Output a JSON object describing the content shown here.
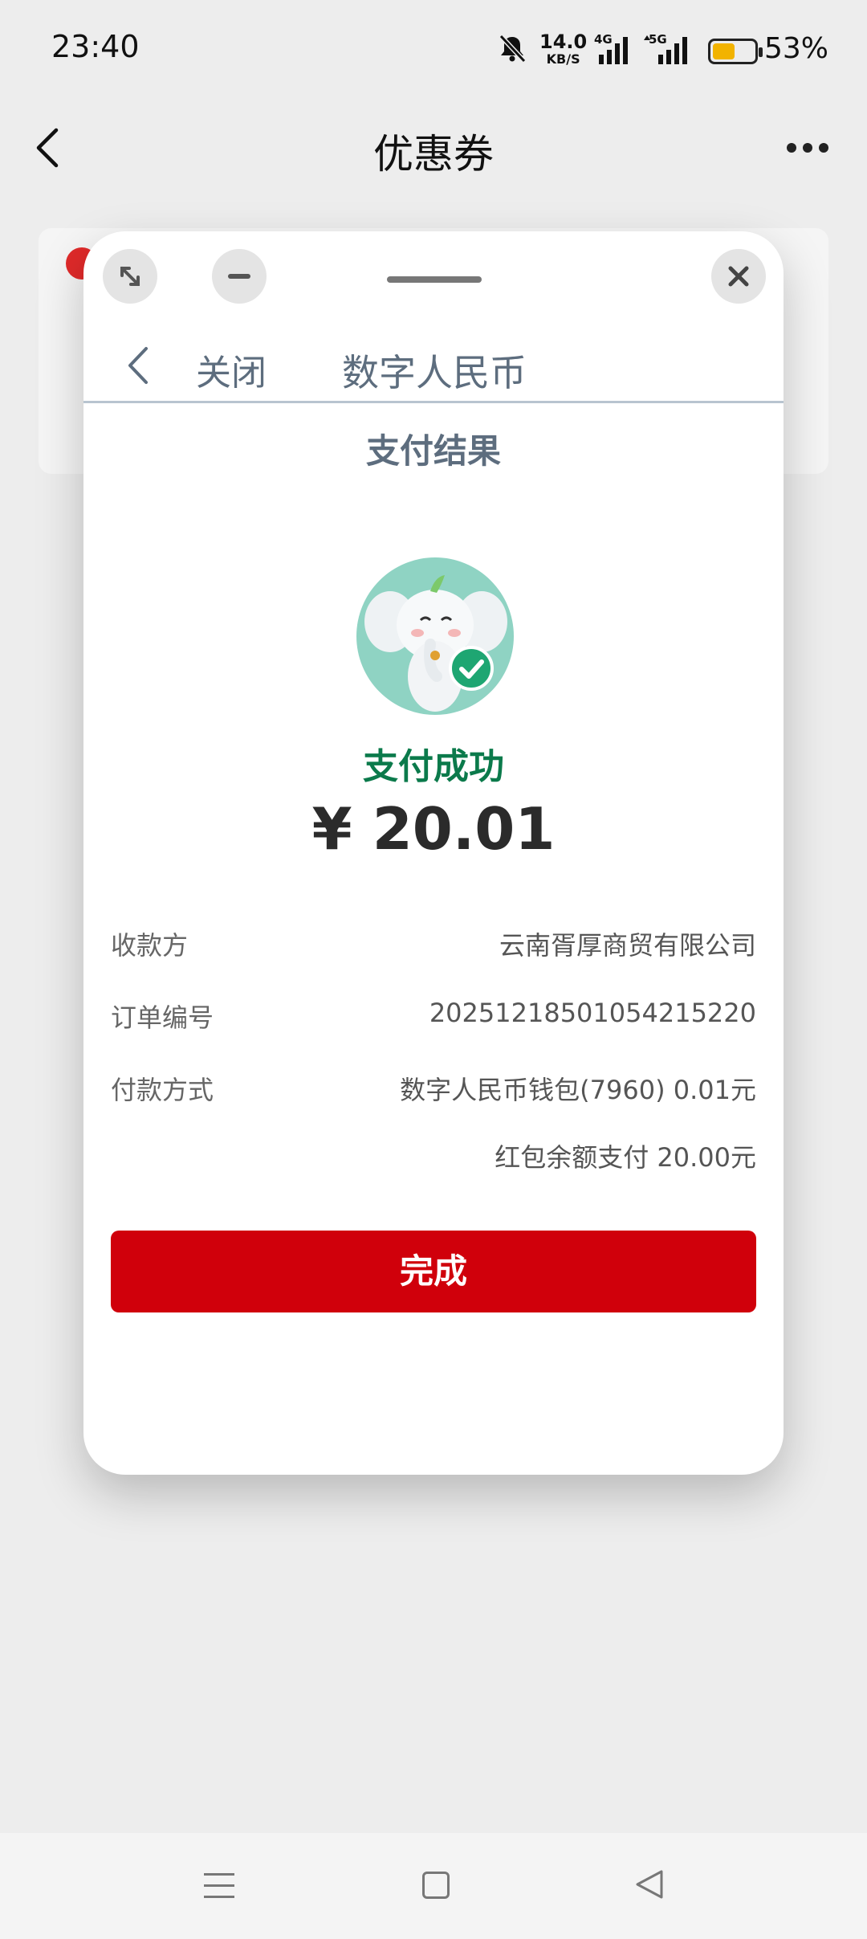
{
  "status_bar": {
    "time": "23:40",
    "net_speed": "14.0",
    "net_unit": "KB/S",
    "signal1": "4G",
    "signal2": "5G",
    "battery_percent": "53%",
    "battery_level": 0.53,
    "icons": [
      "bell-muted-icon",
      "signal-4g-icon",
      "signal-5g-icon",
      "battery-icon"
    ]
  },
  "header": {
    "title": "优惠券",
    "back_icon": "chevron-left-icon",
    "more_icon": "more-dots-icon"
  },
  "modal": {
    "toolbar": {
      "expand_icon": "expand-icon",
      "minimize_icon": "minimize-icon",
      "close_icon": "close-icon"
    },
    "nav": {
      "close_label": "关闭",
      "title": "数字人民币"
    },
    "result_title": "支付结果",
    "status": "支付成功",
    "amount": "¥ 20.01",
    "details": {
      "payee_label": "收款方",
      "payee_value": "云南胥厚商贸有限公司",
      "order_label": "订单编号",
      "order_value": "20251218501054215220",
      "method_label": "付款方式",
      "method_value": "数字人民币钱包(7960) 0.01元",
      "method_value2": "红包余额支付 20.00元"
    },
    "done_button": "完成"
  },
  "colors": {
    "accent_red": "#d0000b",
    "success_green": "#0b7a4b",
    "mascot_bg": "#8fd3c3"
  }
}
